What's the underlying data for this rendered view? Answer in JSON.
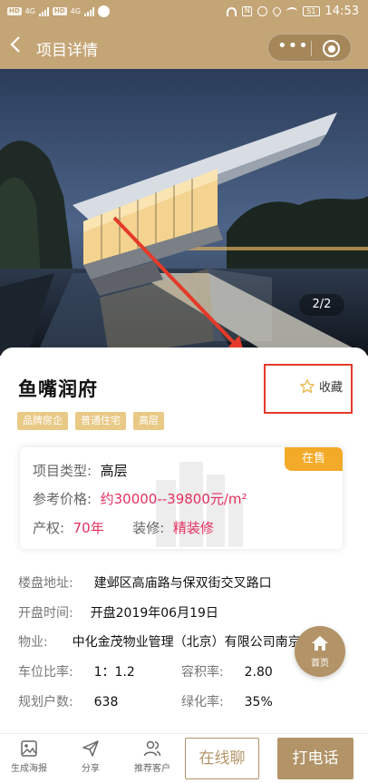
{
  "status_bar": {
    "chip_1": "HD",
    "chip_2": "HD",
    "net_1": "4G",
    "net_2": "4G",
    "battery": "51",
    "time": "14:53"
  },
  "nav": {
    "title": "项目详情",
    "back_icon": "chevron-left-icon",
    "more_icon": "more-dots-icon",
    "close_icon": "target-circle-icon"
  },
  "hero": {
    "counter": "2/2"
  },
  "project": {
    "name": "鱼嘴润府",
    "favorite_label": "收藏",
    "tags": [
      "品牌房企",
      "普通住宅",
      "高层"
    ]
  },
  "info": {
    "status_badge": "在售",
    "type_label": "项目类型:",
    "type_value": "高层",
    "price_label": "参考价格:",
    "price_value": "约30000--39800元/m²",
    "property_right_label": "产权:",
    "property_right_value": "70年",
    "decoration_label": "装修:",
    "decoration_value": "精装修"
  },
  "details": {
    "address_label": "楼盘地址:",
    "address_value": "建邺区高庙路与保双街交叉路口",
    "open_label": "开盘时间:",
    "open_value": "开盘2019年06月19日",
    "property_label": "物业:",
    "property_value": "中化金茂物业管理（北京）有限公司南京分",
    "parking_label": "车位比率:",
    "parking_value": "1：1.2",
    "plot_ratio_label": "容积率:",
    "plot_ratio_value": "2.80",
    "households_label": "规划户数:",
    "households_value": "638",
    "green_label": "绿化率:",
    "green_value": "35%"
  },
  "home_button": {
    "label": "首页",
    "icon": "house-icon"
  },
  "bottom_bar": {
    "poster_label": "生成海报",
    "share_label": "分享",
    "recommend_label": "推荐客户",
    "chat_label": "在线聊",
    "call_label": "打电话"
  },
  "colors": {
    "brand": "#c4a576",
    "button": "#b29468",
    "tag": "#e9c986",
    "badge": "#f3aa28",
    "price": "#e62f5e",
    "annotation": "#e53a2a"
  }
}
